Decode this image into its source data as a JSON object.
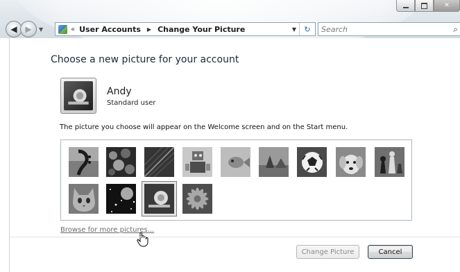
{
  "window": {
    "caption_buttons": [
      "minimize-icon",
      "maximize-icon",
      "close-icon"
    ]
  },
  "nav": {
    "back_icon": "back-arrow-icon",
    "forward_icon": "forward-arrow-icon",
    "recent_icon": "chevron-down-icon"
  },
  "address_bar": {
    "overflow_chevron": "«",
    "crumbs": [
      "User Accounts",
      "Change Your Picture"
    ],
    "refresh_glyph": "↻"
  },
  "search": {
    "placeholder": "Search"
  },
  "page": {
    "title": "Choose a new picture for your account",
    "user_name": "Andy",
    "user_role": "Standard user",
    "info_text": "The picture you choose will appear on the Welcome screen and on the Start menu.",
    "browse_link": "Browse for more pictures..."
  },
  "pictures": [
    {
      "name": "guitar"
    },
    {
      "name": "flowers"
    },
    {
      "name": "leaf"
    },
    {
      "name": "robot"
    },
    {
      "name": "fish"
    },
    {
      "name": "beach"
    },
    {
      "name": "soccer-ball"
    },
    {
      "name": "dog"
    },
    {
      "name": "chess"
    },
    {
      "name": "kitten"
    },
    {
      "name": "space"
    },
    {
      "name": "current-picture",
      "selected": true
    },
    {
      "name": "daisy"
    }
  ],
  "buttons": {
    "change": "Change Picture",
    "cancel": "Cancel"
  }
}
